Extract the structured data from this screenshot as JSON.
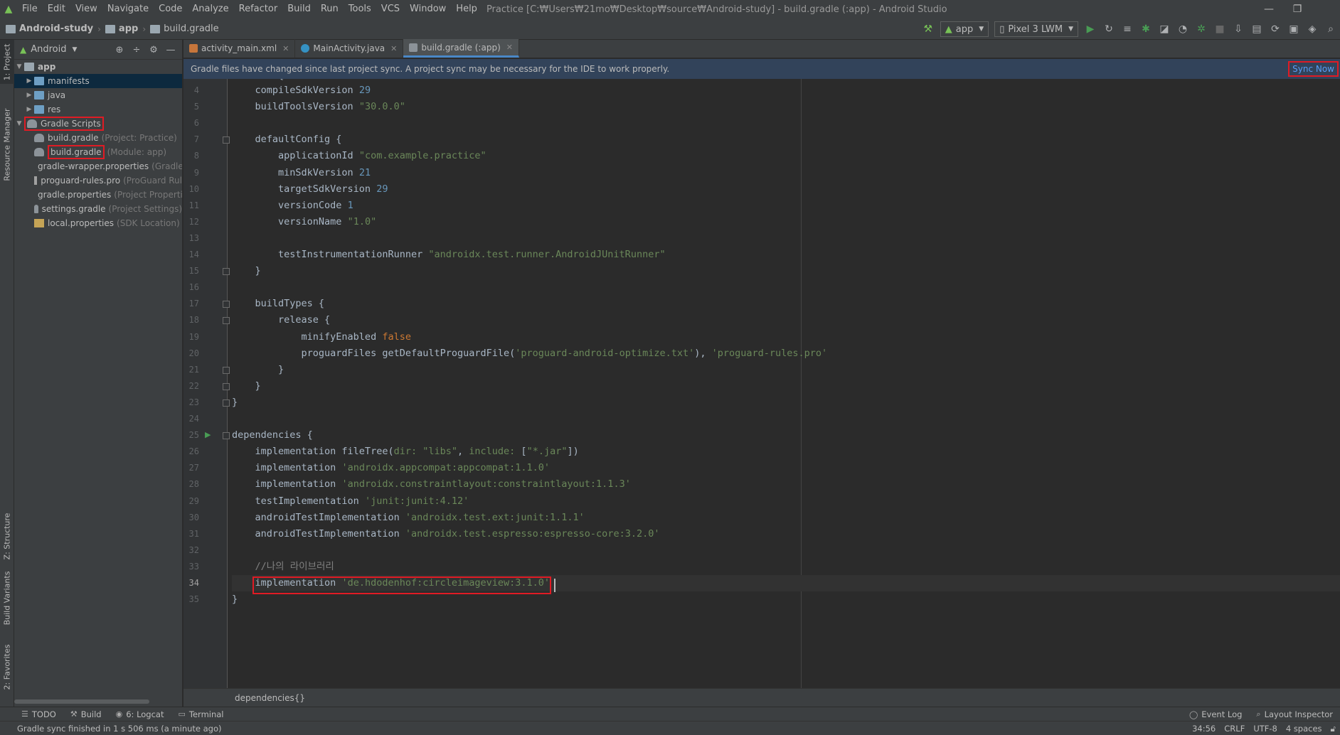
{
  "menu": {
    "items": [
      "File",
      "Edit",
      "View",
      "Navigate",
      "Code",
      "Analyze",
      "Refactor",
      "Build",
      "Run",
      "Tools",
      "VCS",
      "Window",
      "Help"
    ],
    "window_title": "Practice [C:₩Users₩21mo₩Desktop₩source₩Android-study] - build.gradle (:app) - Android Studio"
  },
  "navbar": {
    "crumbs": [
      "Android-study",
      "app",
      "build.gradle"
    ],
    "run_config": "app",
    "device": "Pixel 3 LWM"
  },
  "sidebar_tabs": {
    "project": "1: Project",
    "resource_manager": "Resource Manager",
    "structure": "Z: Structure",
    "build_variants": "Build Variants",
    "favorites": "2: Favorites"
  },
  "project_panel": {
    "view_mode": "Android",
    "tree": [
      {
        "label": "app",
        "sub": ""
      },
      {
        "label": "manifests",
        "sub": ""
      },
      {
        "label": "java",
        "sub": ""
      },
      {
        "label": "res",
        "sub": ""
      },
      {
        "label": "Gradle Scripts",
        "sub": ""
      },
      {
        "label": "build.gradle",
        "sub": "(Project: Practice)"
      },
      {
        "label": "build.gradle",
        "sub": "(Module: app)"
      },
      {
        "label": "gradle-wrapper.properties",
        "sub": "(Gradle"
      },
      {
        "label": "proguard-rules.pro",
        "sub": "(ProGuard Rul"
      },
      {
        "label": "gradle.properties",
        "sub": "(Project Properti"
      },
      {
        "label": "settings.gradle",
        "sub": "(Project Settings)"
      },
      {
        "label": "local.properties",
        "sub": "(SDK Location)"
      }
    ]
  },
  "tabs": [
    {
      "label": "activity_main.xml"
    },
    {
      "label": "MainActivity.java"
    },
    {
      "label": "build.gradle (:app)"
    }
  ],
  "notification": {
    "message": "Gradle files have changed since last project sync. A project sync may be necessary for the IDE to work properly.",
    "action": "Sync Now"
  },
  "editor": {
    "first_line_partial": "android {",
    "line_numbers": [
      "4",
      "5",
      "6",
      "7",
      "8",
      "9",
      "10",
      "11",
      "12",
      "13",
      "14",
      "15",
      "16",
      "17",
      "18",
      "19",
      "20",
      "21",
      "22",
      "23",
      "24",
      "25",
      "26",
      "27",
      "28",
      "29",
      "30",
      "31",
      "32",
      "33",
      "34",
      "35"
    ],
    "current_line": "34",
    "lines": {
      "l4": {
        "a": "    compileSdkVersion ",
        "b": "29"
      },
      "l5": {
        "a": "    buildToolsVersion ",
        "b": "\"30.0.0\""
      },
      "l7": {
        "a": "    defaultConfig {"
      },
      "l8": {
        "a": "        applicationId ",
        "b": "\"com.example.practice\""
      },
      "l9": {
        "a": "        minSdkVersion ",
        "b": "21"
      },
      "l10": {
        "a": "        targetSdkVersion ",
        "b": "29"
      },
      "l11": {
        "a": "        versionCode ",
        "b": "1"
      },
      "l12": {
        "a": "        versionName ",
        "b": "\"1.0\""
      },
      "l14": {
        "a": "        testInstrumentationRunner ",
        "b": "\"androidx.test.runner.AndroidJUnitRunner\""
      },
      "l15": {
        "a": "    }"
      },
      "l17": {
        "a": "    buildTypes {"
      },
      "l18": {
        "a": "        release {"
      },
      "l19": {
        "a": "            minifyEnabled ",
        "b": "false"
      },
      "l20": {
        "a": "            proguardFiles getDefaultProguardFile(",
        "b": "'proguard-android-optimize.txt'",
        "c": "), ",
        "d": "'proguard-rules.pro'"
      },
      "l21": {
        "a": "        }"
      },
      "l22": {
        "a": "    }"
      },
      "l23": {
        "a": "}"
      },
      "l25": {
        "a": "dependencies {"
      },
      "l26": {
        "a": "    implementation fileTree(",
        "b": "dir: ",
        "c": "\"libs\"",
        "d": ", ",
        "e": "include: ",
        "f": "[",
        "g": "\"*.jar\"",
        "h": "])"
      },
      "l27": {
        "a": "    implementation ",
        "b": "'androidx.appcompat:appcompat:1.1.0'"
      },
      "l28": {
        "a": "    implementation ",
        "b": "'androidx.constraintlayout:constraintlayout:1.1.3'"
      },
      "l29": {
        "a": "    testImplementation ",
        "b": "'junit:junit:4.12'"
      },
      "l30": {
        "a": "    androidTestImplementation ",
        "b": "'androidx.test.ext:junit:1.1.1'"
      },
      "l31": {
        "a": "    androidTestImplementation ",
        "b": "'androidx.test.espresso:espresso-core:3.2.0'"
      },
      "l33": {
        "a": "    //나의 라이브러리"
      },
      "l34": {
        "a": "    implementation ",
        "b": "'de.hdodenhof:circleimageview:3.1.0'"
      },
      "l35": {
        "a": "}"
      }
    }
  },
  "breadcrumb_bottom": "dependencies{}",
  "bottom_tools": {
    "todo": "TODO",
    "build": "Build",
    "logcat": "6: Logcat",
    "terminal": "Terminal",
    "event_log": "Event Log",
    "layout_inspector": "Layout Inspector"
  },
  "status": {
    "message": "Gradle sync finished in 1 s 506 ms (a minute ago)",
    "position": "34:56",
    "line_sep": "CRLF",
    "encoding": "UTF-8",
    "indent": "4 spaces"
  },
  "colors": {
    "accent": "#4a88c7",
    "highlight": "#e01b24",
    "android_green": "#78c257"
  }
}
